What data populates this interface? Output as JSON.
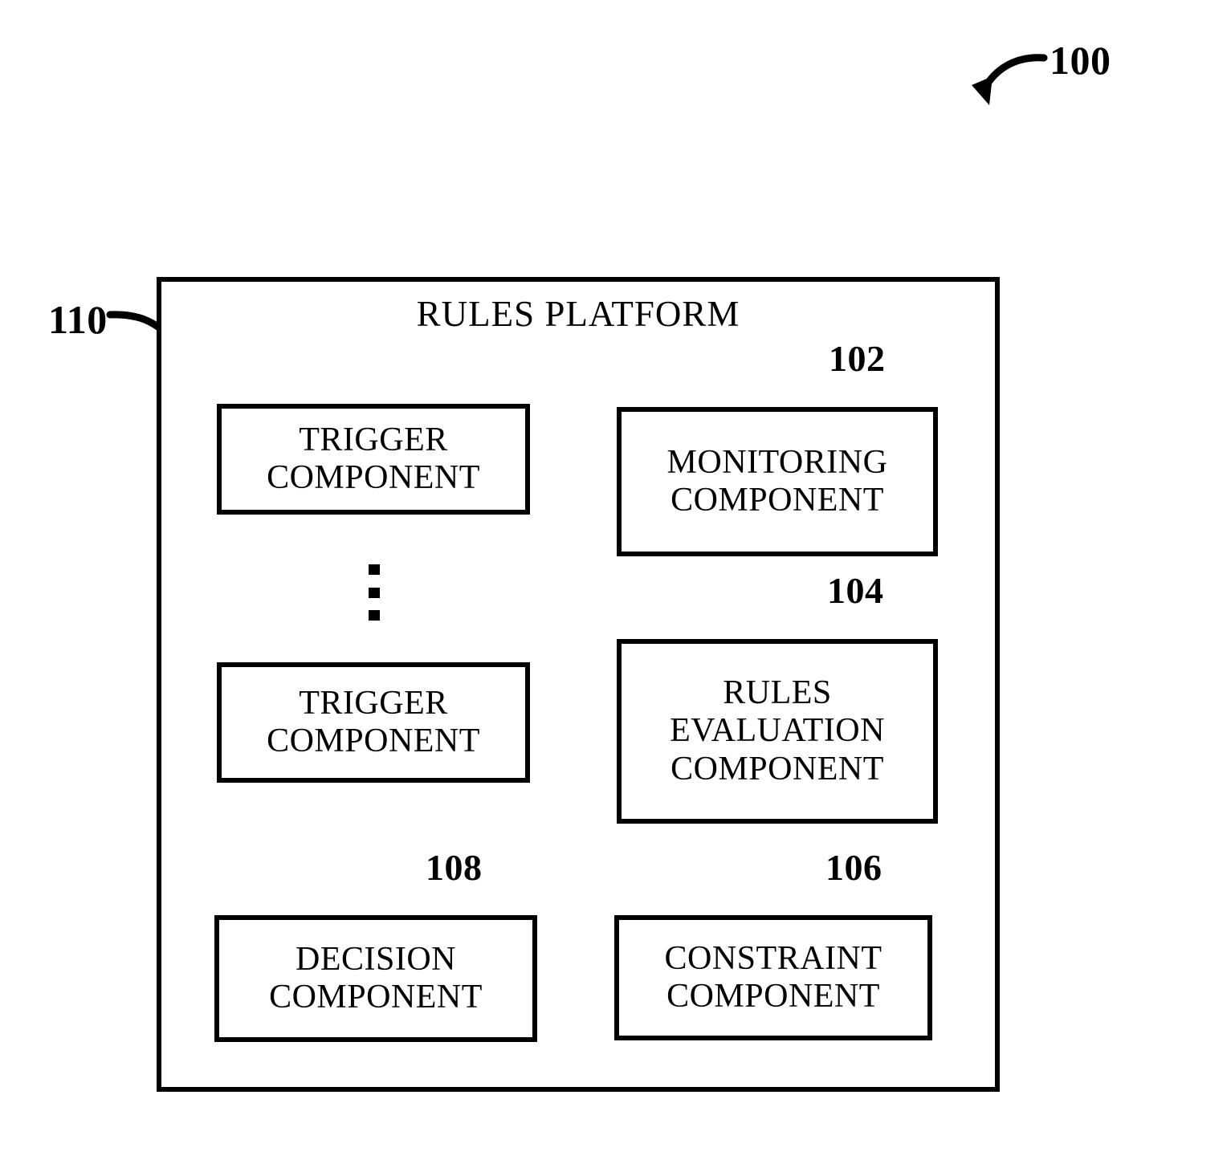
{
  "figure": {
    "figure_ref": "100",
    "platform_ref": "110",
    "title": "RULES PLATFORM"
  },
  "components": [
    {
      "id": "trigger-1",
      "lines": [
        "TRIGGER",
        "COMPONENT"
      ],
      "ref": ""
    },
    {
      "id": "trigger-2",
      "lines": [
        "TRIGGER",
        "COMPONENT"
      ],
      "ref": ""
    },
    {
      "id": "monitoring",
      "lines": [
        "MONITORING",
        "COMPONENT"
      ],
      "ref": "102"
    },
    {
      "id": "rules-evaluation",
      "lines": [
        "RULES",
        "EVALUATION",
        "COMPONENT"
      ],
      "ref": "104"
    },
    {
      "id": "decision",
      "lines": [
        "DECISION",
        "COMPONENT"
      ],
      "ref": "108"
    },
    {
      "id": "constraint",
      "lines": [
        "CONSTRAINT",
        "COMPONENT"
      ],
      "ref": "106"
    }
  ],
  "ellipsis": {
    "symbol": "vertical-ellipsis",
    "dot_count": 3
  },
  "colors": {
    "ink": "#000000",
    "background": "#ffffff"
  }
}
